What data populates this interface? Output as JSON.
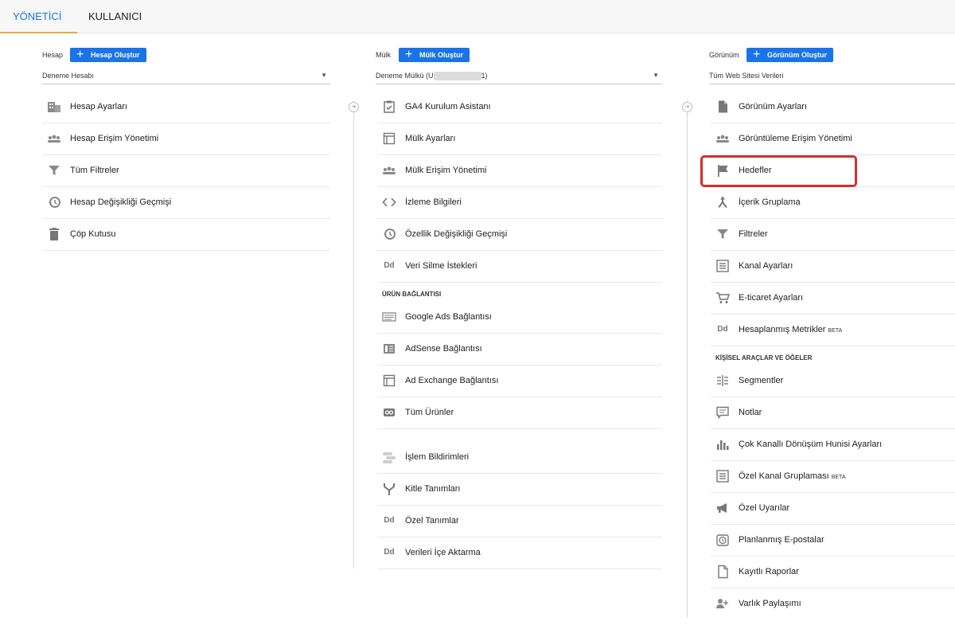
{
  "tabs": [
    "YÖNETİCİ",
    "KULLANICI"
  ],
  "account": {
    "label": "Hesap",
    "create": "Hesap Oluştur",
    "selected": "Deneme Hesabı",
    "items": [
      {
        "icon": "building-icon",
        "label": "Hesap Ayarları"
      },
      {
        "icon": "people-icon",
        "label": "Hesap Erişim Yönetimi"
      },
      {
        "icon": "filter-icon",
        "label": "Tüm Filtreler"
      },
      {
        "icon": "history-icon",
        "label": "Hesap Değişikliği Geçmişi"
      },
      {
        "icon": "trash-icon",
        "label": "Çöp Kutusu"
      }
    ]
  },
  "property": {
    "label": "Mülk",
    "create": "Mülk Oluştur",
    "selected_prefix": "Deneme Mülkü (U",
    "selected_suffix": "1)",
    "items": [
      {
        "icon": "checklist-icon",
        "label": "GA4 Kurulum Asistanı"
      },
      {
        "icon": "window-icon",
        "label": "Mülk Ayarları"
      },
      {
        "icon": "people-icon",
        "label": "Mülk Erişim Yönetimi"
      },
      {
        "icon": "code-icon",
        "label": "İzleme Bilgileri"
      },
      {
        "icon": "history-icon",
        "label": "Özellik Değişikliği Geçmişi"
      },
      {
        "icon": "dd-icon",
        "label": "Veri Silme İstekleri"
      }
    ],
    "section": "ÜRÜN BAĞLANTISI",
    "links": [
      {
        "icon": "ads-icon",
        "label": "Google Ads Bağlantısı"
      },
      {
        "icon": "adsense-icon",
        "label": "AdSense Bağlantısı"
      },
      {
        "icon": "window-icon",
        "label": "Ad Exchange Bağlantısı"
      },
      {
        "icon": "link-icon",
        "label": "Tüm Ürünler"
      }
    ],
    "more": [
      {
        "icon": "toggle-icon",
        "label": "İşlem Bildirimleri"
      },
      {
        "icon": "fork-icon",
        "label": "Kitle Tanımları"
      },
      {
        "icon": "dd-icon",
        "label": "Özel Tanımlar"
      },
      {
        "icon": "dd-icon",
        "label": "Verileri İçe Aktarma"
      }
    ]
  },
  "view": {
    "label": "Görünüm",
    "create": "Görünüm Oluştur",
    "selected": "Tüm Web Sitesi Verileri",
    "items": [
      {
        "icon": "document-icon",
        "label": "Görünüm Ayarları"
      },
      {
        "icon": "people-icon",
        "label": "Görüntüleme Erişim Yönetimi"
      },
      {
        "icon": "flag-icon",
        "label": "Hedefler"
      },
      {
        "icon": "grouping-icon",
        "label": "İçerik Gruplama"
      },
      {
        "icon": "filter-icon",
        "label": "Filtreler"
      },
      {
        "icon": "channel-icon",
        "label": "Kanal Ayarları"
      },
      {
        "icon": "cart-icon",
        "label": "E-ticaret Ayarları"
      },
      {
        "icon": "dd-icon",
        "label": "Hesaplanmış Metrikler",
        "badge": "BETA"
      }
    ],
    "section": "KİŞİSEL ARAÇLAR VE ÖĞELER",
    "tools": [
      {
        "icon": "segments-icon",
        "label": "Segmentler"
      },
      {
        "icon": "note-icon",
        "label": "Notlar"
      },
      {
        "icon": "bars-icon",
        "label": "Çok Kanallı Dönüşüm Hunisi Ayarları"
      },
      {
        "icon": "channel-icon",
        "label": "Özel Kanal Gruplaması",
        "badge": "BETA"
      },
      {
        "icon": "megaphone-icon",
        "label": "Özel Uyarılar"
      },
      {
        "icon": "clock-icon",
        "label": "Planlanmış E-postalar"
      },
      {
        "icon": "document-icon",
        "label": "Kayıtlı Raporlar"
      },
      {
        "icon": "share-icon",
        "label": "Varlık Paylaşımı"
      }
    ]
  }
}
